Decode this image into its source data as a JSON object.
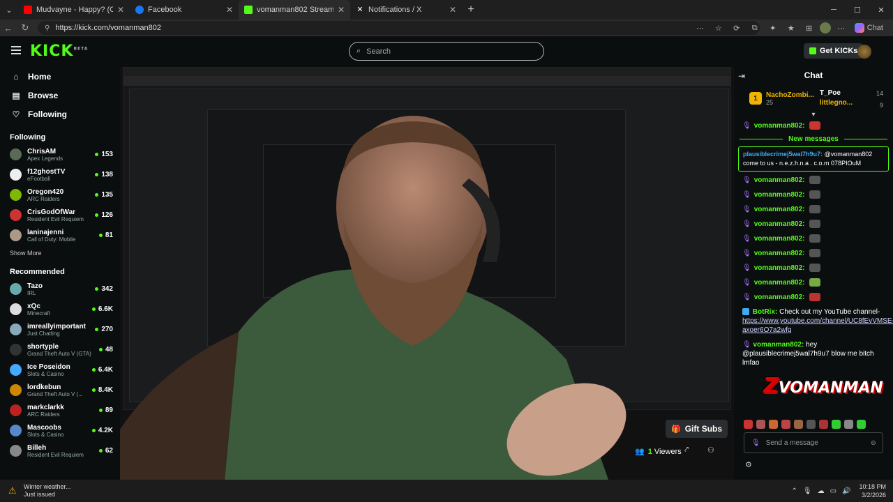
{
  "browser": {
    "tabs": [
      {
        "label": "Mudvayne - Happy? (Official",
        "color": "#ff0000"
      },
      {
        "label": "Facebook",
        "color": "#1877f2"
      },
      {
        "label": "vomanman802 Stream - Watch Li",
        "color": "#53fc18"
      },
      {
        "label": "Notifications / X",
        "color": "#ffffff"
      }
    ],
    "url": "https://kick.com/vomanman802",
    "copilot_label": "Chat"
  },
  "header": {
    "logo": "KICK",
    "logo_sup": "BETA",
    "search_placeholder": "Search",
    "get_kicks": "Get KICKs"
  },
  "sidebar": {
    "nav": [
      {
        "label": "Home",
        "icon": "home-icon"
      },
      {
        "label": "Browse",
        "icon": "browse-icon"
      },
      {
        "label": "Following",
        "icon": "heart-icon"
      }
    ],
    "following_title": "Following",
    "following": [
      {
        "name": "ChrisAM",
        "game": "Apex Legends",
        "viewers": "153",
        "color": "#5a6b55"
      },
      {
        "name": "f12ghostTV",
        "game": "eFootball",
        "viewers": "138",
        "color": "#eee"
      },
      {
        "name": "Oregon420",
        "game": "ARC Raiders",
        "viewers": "135",
        "color": "#7fb800"
      },
      {
        "name": "CrisGodOfWar",
        "game": "Resident Evil Requiem",
        "viewers": "126",
        "color": "#c33"
      },
      {
        "name": "laninajenni",
        "game": "Call of Duty: Mobile",
        "viewers": "81",
        "color": "#a98"
      }
    ],
    "show_more": "Show More",
    "recommended_title": "Recommended",
    "recommended": [
      {
        "name": "Tazo",
        "game": "IRL",
        "viewers": "342",
        "color": "#6aa"
      },
      {
        "name": "xQc",
        "game": "Minecraft",
        "viewers": "6.6K",
        "color": "#ddd"
      },
      {
        "name": "imreallyimportant",
        "game": "Just Chatting",
        "viewers": "270",
        "color": "#8ab"
      },
      {
        "name": "shortyple",
        "game": "Grand Theft Auto V (GTA)",
        "viewers": "48",
        "color": "#333"
      },
      {
        "name": "Ice Poseidon",
        "game": "Slots & Casino",
        "viewers": "6.4K",
        "color": "#4af"
      },
      {
        "name": "lordkebun",
        "game": "Grand Theft Auto V (...",
        "viewers": "8.4K",
        "color": "#c80"
      },
      {
        "name": "markclarkk",
        "game": "ARC Raiders",
        "viewers": "89",
        "color": "#b22"
      },
      {
        "name": "Mascoobs",
        "game": "Slots & Casino",
        "viewers": "4.2K",
        "color": "#58c"
      },
      {
        "name": "Billeh",
        "game": "Resident Evil Requiem",
        "viewers": "62",
        "color": "#888"
      }
    ]
  },
  "stream": {
    "gift_subs": "Gift Subs",
    "viewers_count": "1",
    "viewers_label": "Viewers"
  },
  "chat": {
    "title": "Chat",
    "leader1_rank": "1",
    "leader1_name": "NachoZombi...",
    "leader1_count": "25",
    "leader2_name": "T_Poe",
    "leader2_count": "14",
    "leader3_name": "littlegno...",
    "leader3_count": "9",
    "first_user": "vomanman802:",
    "new_messages": "New messages",
    "highlight_user": "plausiblecrimej5wal7h9u7:",
    "highlight_text": "@vomanman802 come to us - n.e.z.h.n.a . c.o.m 078PIOuM",
    "repeat_user": "vomanman802:",
    "emote_msgs": 9,
    "bot_name": "BotRix:",
    "bot_text": "Check out my YouTube channel-",
    "bot_link": "https://www.youtube.com/channel/UC8fEvVMSE-axoer6O7a2wfg",
    "last_user": "vomanman802:",
    "last_text": "hey @plausiblecrimej5wal7h9u7 blow me bitch lmfao",
    "input_placeholder": "Send a message",
    "overlay_logo": "VOMANMAN"
  },
  "taskbar": {
    "weather_title": "Winter weather...",
    "weather_sub": "Just issued",
    "time": "10:18 PM",
    "date": "3/2/2026"
  }
}
